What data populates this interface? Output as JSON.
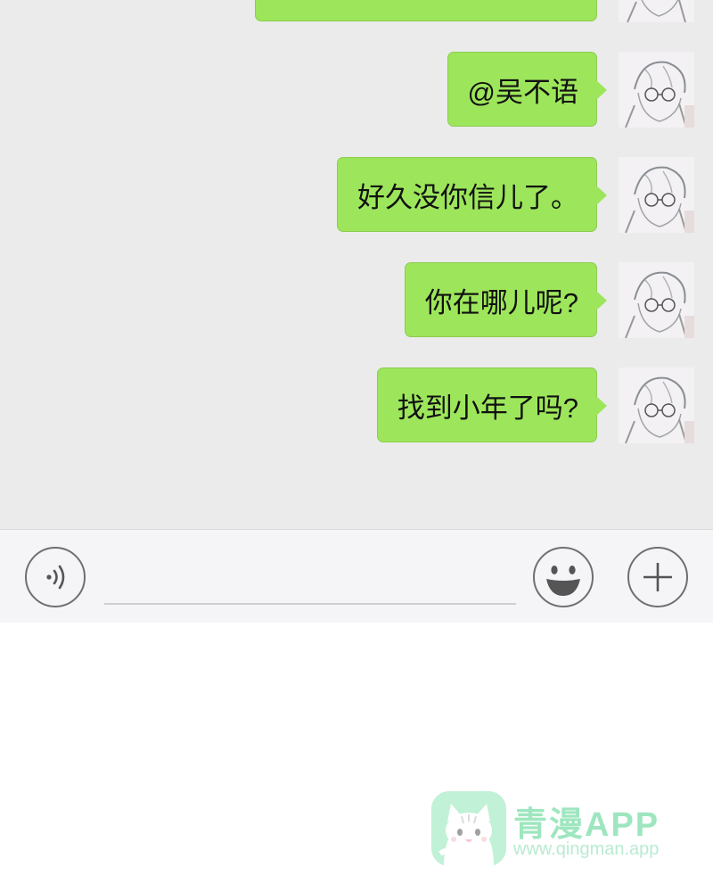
{
  "messages": [
    {
      "text": ""
    },
    {
      "text": "@吴不语"
    },
    {
      "text": "好久没你信儿了。"
    },
    {
      "text": "你在哪儿呢?"
    },
    {
      "text": "找到小年了吗?"
    }
  ],
  "input_bar": {
    "voice_icon": "voice-wave-icon",
    "emoji_icon": "smiley-face-icon",
    "plus_icon": "plus-icon",
    "input_value": "",
    "input_placeholder": ""
  },
  "watermark": {
    "title": "青漫APP",
    "url": "www.qingman.app"
  },
  "colors": {
    "chat_background": "#ebebeb",
    "bubble": "#9de65b",
    "input_bar": "#f5f5f7",
    "watermark": "#4fd38c"
  }
}
